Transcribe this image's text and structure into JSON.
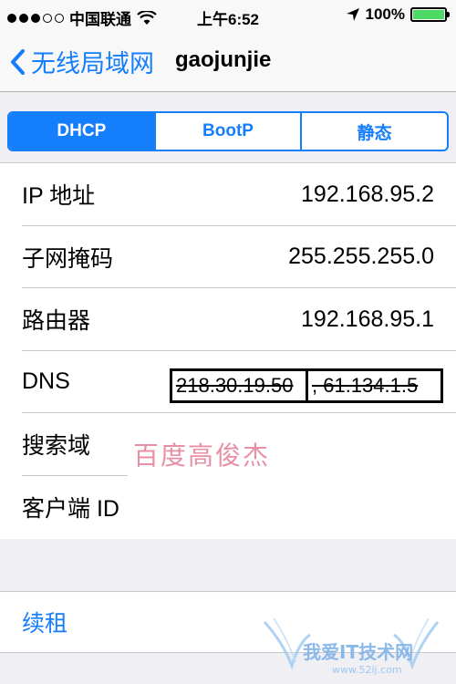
{
  "status_bar": {
    "carrier": "中国联通",
    "time": "上午6:52",
    "battery": "100%",
    "signal_bars_on": 3,
    "signal_bars_total": 5,
    "battery_level": 1.0,
    "battery_color": "#4cd964"
  },
  "nav": {
    "back_label": "无线局域网",
    "title": "gaojunjie",
    "accent": "#157efb"
  },
  "segments": [
    {
      "label": "DHCP",
      "active": true
    },
    {
      "label": "BootP",
      "active": false
    },
    {
      "label": "静态",
      "active": false
    }
  ],
  "fields": [
    {
      "label": "IP 地址",
      "value": "192.168.95.2"
    },
    {
      "label": "子网掩码",
      "value": "255.255.255.0"
    },
    {
      "label": "路由器",
      "value": "192.168.95.1"
    },
    {
      "label": "DNS",
      "value_part1": "218.30.19.50",
      "value_part2": ", 61.134.1.5"
    },
    {
      "label": "搜索域",
      "value": ""
    },
    {
      "label": "客户端 ID",
      "value": ""
    }
  ],
  "renew_label": "续租",
  "watermark_text": "百度高俊杰",
  "site_logo": {
    "text": "我爱IT技术网",
    "url_text": "www.52ij.com"
  }
}
